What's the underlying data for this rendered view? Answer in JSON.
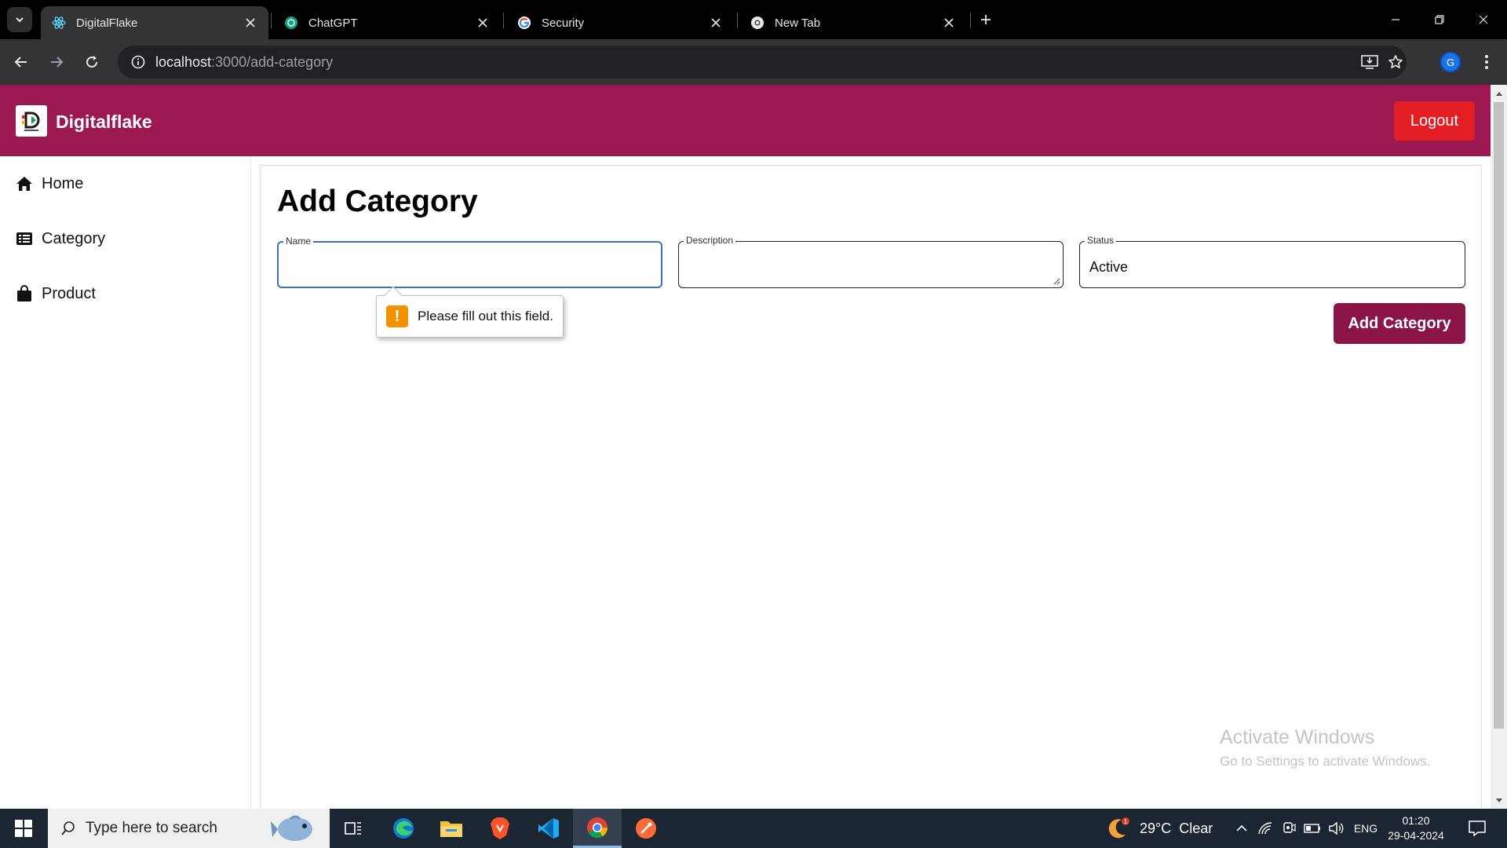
{
  "browser": {
    "tabs": [
      {
        "title": "DigitalFlake",
        "active": true
      },
      {
        "title": "ChatGPT",
        "active": false
      },
      {
        "title": "Security",
        "active": false
      },
      {
        "title": "New Tab",
        "active": false
      }
    ],
    "url_host": "localhost",
    "url_path": ":3000/add-category",
    "profile_initial": "G"
  },
  "header": {
    "brand": "Digitalflake",
    "logout_label": "Logout"
  },
  "sidebar": {
    "items": [
      {
        "label": "Home",
        "icon": "home-icon"
      },
      {
        "label": "Category",
        "icon": "list-icon"
      },
      {
        "label": "Product",
        "icon": "shopping-bag-icon"
      }
    ]
  },
  "form": {
    "title": "Add Category",
    "name_label": "Name",
    "name_value": "",
    "description_label": "Description",
    "description_value": "",
    "status_label": "Status",
    "status_value": "Active",
    "submit_label": "Add Category"
  },
  "validation": {
    "message": "Please fill out this field."
  },
  "watermark": {
    "title": "Activate Windows",
    "subtitle": "Go to Settings to activate Windows."
  },
  "taskbar": {
    "search_placeholder": "Type here to search",
    "weather": "29°C  Clear",
    "weather_badge": "1",
    "language": "ENG",
    "time": "01:20",
    "date": "29-04-2024"
  },
  "colors": {
    "header_bg": "#9c1850",
    "logout_bg": "#e31e24",
    "submit_bg": "#8b1547",
    "focus_border": "#3b71ca",
    "warning": "#f39200"
  }
}
